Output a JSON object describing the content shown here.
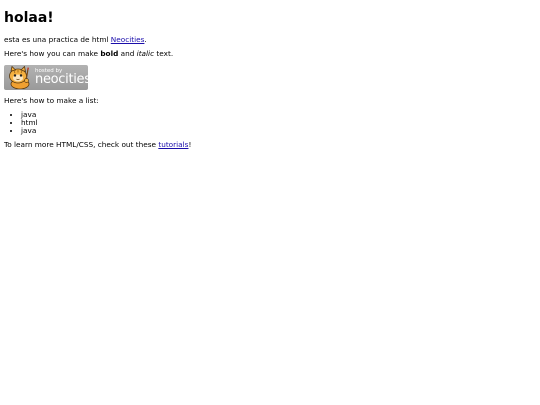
{
  "heading": "holaa!",
  "intro": {
    "text_before": "esta es una practica de html ",
    "link_text": "Neocities",
    "text_after": "."
  },
  "formatting": {
    "text_before": "Here's how you can make ",
    "bold_text": "bold",
    "middle_text": " and ",
    "italic_text": "italic",
    "text_after": " text."
  },
  "badge": {
    "small_text": "hosted by",
    "big_text": "neocities"
  },
  "list_intro": "Here's how to make a list:",
  "list_items": [
    "java",
    "html",
    "java"
  ],
  "outro": {
    "text_before": "To learn more HTML/CSS, check out these ",
    "link_text": "tutorials",
    "text_after": "!"
  },
  "colors": {
    "link": "#1a0dab",
    "badge_background": "#a8a8a8",
    "cat_orange": "#f0a030"
  }
}
